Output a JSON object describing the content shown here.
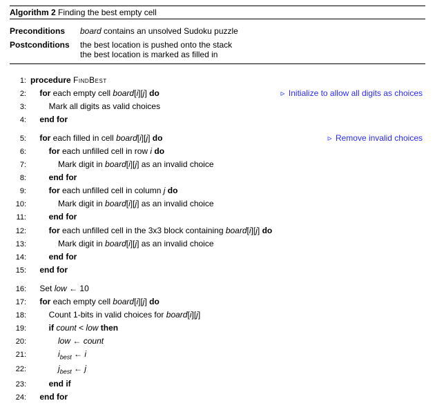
{
  "algo": {
    "label": "Algorithm 2",
    "title": "Finding the best empty cell"
  },
  "preconditions": {
    "label": "Preconditions",
    "text_before": "",
    "board_var": "board",
    "text_after": " contains an unsolved Sudoku puzzle"
  },
  "postconditions": {
    "label": "Postconditions",
    "line1": "the best location is pushed onto the stack",
    "line2": "the best location is marked as filled in"
  },
  "kw": {
    "procedure": "procedure",
    "for": "for",
    "do": "do",
    "endfor": "end for",
    "if": "if",
    "then": "then",
    "endif": "end if"
  },
  "proc_name": "FindBest",
  "vars": {
    "board": "board",
    "i": "i",
    "j": "j",
    "low": "low",
    "count": "count",
    "ibest_base": "i",
    "ibest_sub": "best",
    "jbest_base": "j",
    "jbest_sub": "best",
    "arrow": "←",
    "lt": "<",
    "ten": "10"
  },
  "txt": {
    "each_empty_cell": " each empty cell ",
    "each_filled_cell": " each filled in cell ",
    "mark_all_valid": "Mark all digits as valid choices",
    "each_unfilled_row": " each unfilled cell in row ",
    "each_unfilled_col": " each unfilled cell in column ",
    "each_unfilled_block_pre": " each unfilled cell in the 3x3 block containing ",
    "mark_digit_pre": "Mark digit in ",
    "mark_digit_post": " as an invalid choice",
    "set_low": "Set ",
    "count_bits_pre": "Count 1-bits in valid choices for "
  },
  "comments": {
    "init": "Initialize to allow all digits as choices",
    "remove": "Remove invalid choices"
  },
  "ln": {
    "l1": "1:",
    "l2": "2:",
    "l3": "3:",
    "l4": "4:",
    "l5": "5:",
    "l6": "6:",
    "l7": "7:",
    "l8": "8:",
    "l9": "9:",
    "l10": "10:",
    "l11": "11:",
    "l12": "12:",
    "l13": "13:",
    "l14": "14:",
    "l15": "15:",
    "l16": "16:",
    "l17": "17:",
    "l18": "18:",
    "l19": "19:",
    "l20": "20:",
    "l21": "21:",
    "l22": "22:",
    "l23": "23:",
    "l24": "24:"
  }
}
